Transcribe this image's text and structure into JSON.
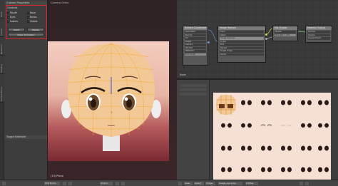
{
  "left_panel": {
    "tabs": [
      "Tools",
      "Create",
      "Relations",
      "Shading",
      "Grease Pencil"
    ],
    "header": "Custom Properties",
    "panel_title": "Controls",
    "checks": [
      {
        "label": "Mouth",
        "checked": true
      },
      {
        "label": "Nose",
        "checked": true
      },
      {
        "label": "Eyes",
        "checked": true
      },
      {
        "label": "Brows",
        "checked": true
      },
      {
        "label": "Lashes",
        "checked": true
      },
      {
        "label": "Visible",
        "checked": true
      }
    ],
    "insert_label": "Insert",
    "delete_label": "Delete",
    "clear_label": "Clear Animation",
    "panel2_title": "Toggle Editmode"
  },
  "viewport": {
    "title": "Camera Ortho",
    "object_label": "(13) Plane"
  },
  "node_editor": {
    "label": "Node",
    "nodes": [
      {
        "title": "Texture Coordinate",
        "fields": [
          "Generated",
          "Normal",
          "UV",
          "Object",
          "Camera",
          "Window",
          "Reflection",
          "From Dupli"
        ]
      },
      {
        "title": "Image Texture",
        "fields": [
          "Color",
          "Alpha",
          "Image_eyes.tga",
          "Linear",
          "Flat",
          "Repeat",
          "Single Image",
          "Vector"
        ]
      },
      {
        "title": "Mix Shader",
        "fields": [
          "Shader",
          "Strength: 1.000"
        ]
      },
      {
        "title": "Material Output",
        "fields": [
          "Surface",
          "Volume",
          "Displacement"
        ]
      }
    ]
  },
  "bottom_bar": {
    "mode": "Edit Mode",
    "pivot": "Global",
    "uvmap": "UVMap",
    "image": "Image_eyes.tga",
    "view": "View",
    "select": "Select",
    "image_menu": "Image"
  },
  "colors": {
    "highlight_border": "#d9262b",
    "skin": "#f2c896",
    "mesh_wire": "#f5a623",
    "texture_bg": "#f6e0d4"
  }
}
